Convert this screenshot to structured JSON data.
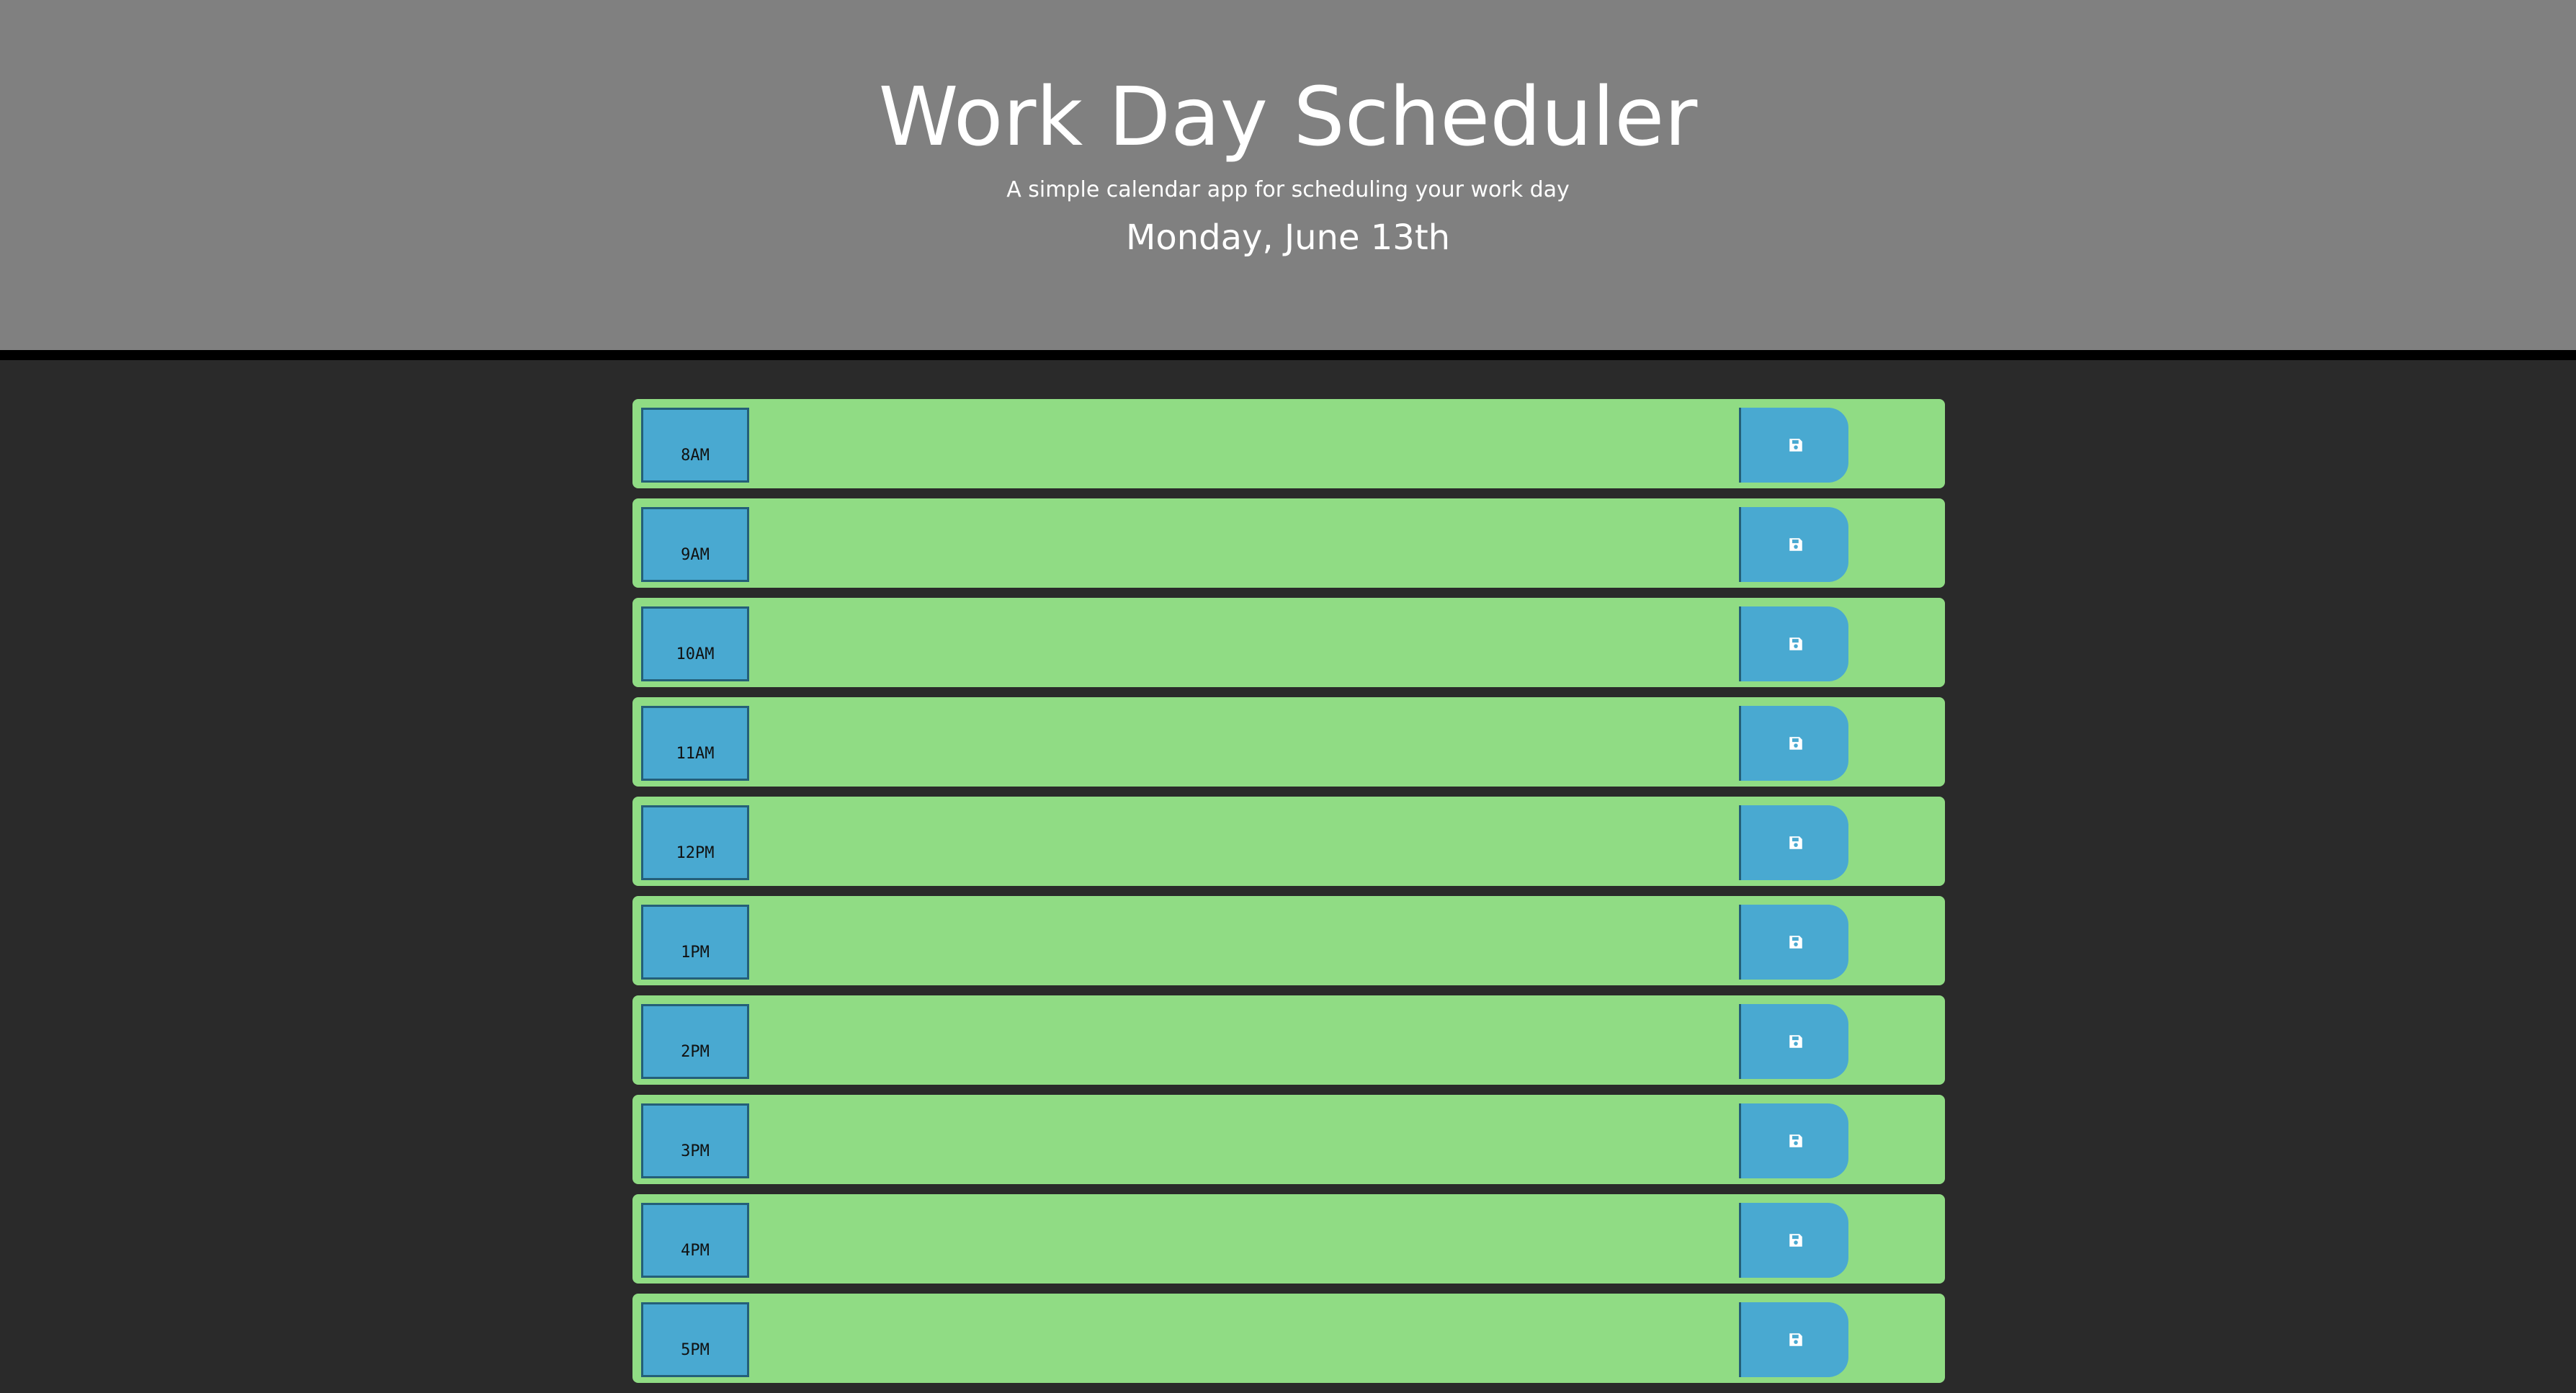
{
  "header": {
    "title": "Work Day Scheduler",
    "subtitle": "A simple calendar app for scheduling your work day",
    "date": "Monday, June 13th"
  },
  "colors": {
    "header_bg": "#808080",
    "page_bg": "#2a2a2a",
    "row_bg": "#90dc84",
    "hour_bg": "#49a9d1",
    "save_bg": "#49a9d1"
  },
  "rows": [
    {
      "hour": "8AM",
      "text": ""
    },
    {
      "hour": "9AM",
      "text": ""
    },
    {
      "hour": "10AM",
      "text": ""
    },
    {
      "hour": "11AM",
      "text": ""
    },
    {
      "hour": "12PM",
      "text": ""
    },
    {
      "hour": "1PM",
      "text": ""
    },
    {
      "hour": "2PM",
      "text": ""
    },
    {
      "hour": "3PM",
      "text": ""
    },
    {
      "hour": "4PM",
      "text": ""
    },
    {
      "hour": "5PM",
      "text": ""
    }
  ],
  "save_icon": "floppy-disk-icon"
}
